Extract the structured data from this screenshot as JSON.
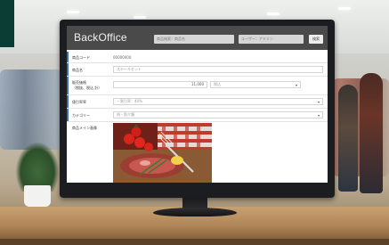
{
  "app": {
    "title": "BackOffice",
    "search_field": {
      "placeholder": "商品検索：商品名"
    },
    "user_field": {
      "placeholder": "ユーザー：アドミン"
    },
    "search_button": "検索"
  },
  "form": {
    "product_code": {
      "label": "商品コード",
      "value": "00000000"
    },
    "product_name": {
      "label": "商品名",
      "placeholder": "ステーキセット"
    },
    "price": {
      "label_line1": "販売価格",
      "label_line2": "（税抜、税込 計）",
      "value": "11,000",
      "tax_option": "税込"
    },
    "discount": {
      "label": "値引率率",
      "value": "－割引率：40%"
    },
    "category": {
      "label": "カテゴリー",
      "value": "肉・魚介類"
    },
    "main_image": {
      "label": "商品メイン画像"
    }
  },
  "colors": {
    "header_bg": "#4a4a4a",
    "row_accent": "#3a6fb0",
    "store_sign": "#0b3d35"
  }
}
